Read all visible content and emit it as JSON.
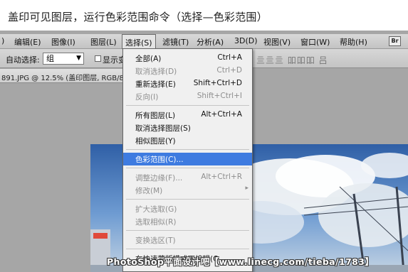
{
  "caption": "盖印可见图层，运行色彩范围命令（选择—色彩范围）",
  "menubar": {
    "items": [
      ")",
      "编辑(E)",
      "图像(I)",
      "图层(L)",
      "选择(S)",
      "滤镜(T)",
      "分析(A)",
      "3D(D)",
      "视图(V)",
      "窗口(W)",
      "帮助(H)"
    ],
    "active": "选择(S)",
    "right_box": "Br"
  },
  "optionsbar": {
    "auto_select_label": "自动选择:",
    "auto_select_value": "组",
    "show_label": "显示变",
    "align_icons": "亖亖亖  吅吅吅  吕"
  },
  "document_tab": "891.JPG @ 12.5% (盖印图层, RGB/8",
  "select_menu": {
    "items": [
      {
        "label": "全部(A)",
        "shortcut": "Ctrl+A",
        "state": "enabled"
      },
      {
        "label": "取消选择(D)",
        "shortcut": "Ctrl+D",
        "state": "disabled"
      },
      {
        "label": "重新选择(E)",
        "shortcut": "Shift+Ctrl+D",
        "state": "enabled"
      },
      {
        "label": "反向(I)",
        "shortcut": "Shift+Ctrl+I",
        "state": "disabled"
      },
      {
        "label": "所有图层(L)",
        "shortcut": "Alt+Ctrl+A",
        "state": "enabled"
      },
      {
        "label": "取消选择图层(S)",
        "shortcut": "",
        "state": "enabled"
      },
      {
        "label": "相似图层(Y)",
        "shortcut": "",
        "state": "enabled"
      },
      {
        "label": "色彩范围(C)...",
        "shortcut": "",
        "state": "highlighted"
      },
      {
        "label": "调整边缘(F)...",
        "shortcut": "Alt+Ctrl+R",
        "state": "disabled"
      },
      {
        "label": "修改(M)",
        "shortcut": "",
        "state": "disabled",
        "submenu_arrow": "▸"
      },
      {
        "label": "扩大选取(G)",
        "shortcut": "",
        "state": "disabled"
      },
      {
        "label": "选取相似(R)",
        "shortcut": "",
        "state": "disabled"
      },
      {
        "label": "变换选区(T)",
        "shortcut": "",
        "state": "disabled"
      },
      {
        "label": "在快速蒙版模式下编辑(Q",
        "shortcut": "",
        "state": "enabled"
      }
    ]
  },
  "watermark": "PhotoShop平面设计吧【www.linecg.com/tieba/1783】"
}
